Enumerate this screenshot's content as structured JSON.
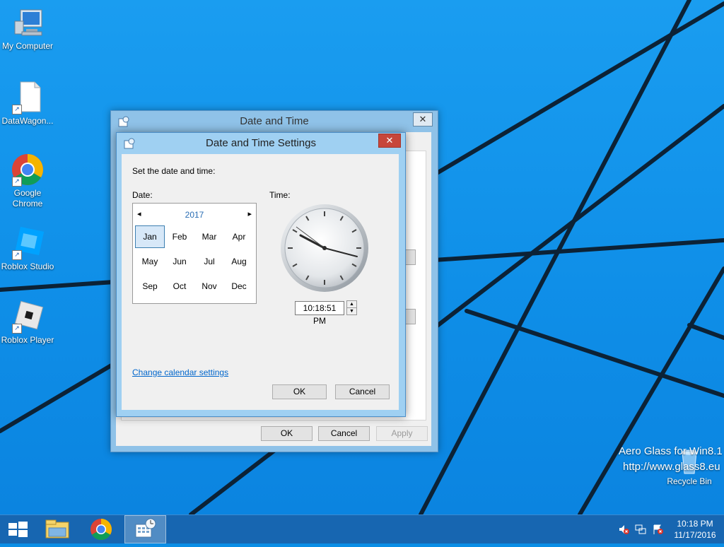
{
  "desktop": {
    "icons": [
      {
        "label": "My Computer"
      },
      {
        "label": "DataWagon..."
      },
      {
        "label": "Google Chrome"
      },
      {
        "label": "Roblox Studio"
      },
      {
        "label": "Roblox Player"
      },
      {
        "label": "Recycle Bin"
      }
    ],
    "watermark_line1": "Aero Glass for Win8.1",
    "watermark_line2": "http://www.glass8.eu"
  },
  "outer_dialog": {
    "title": "Date and Time",
    "close_label": "✕",
    "ok_label": "OK",
    "cancel_label": "Cancel",
    "apply_label": "Apply"
  },
  "inner_dialog": {
    "title": "Date and Time Settings",
    "close_label": "✕",
    "instruction": "Set the date and time:",
    "date_label": "Date:",
    "time_label": "Time:",
    "calendar": {
      "year": "2017",
      "prev_label": "◂",
      "next_label": "▸",
      "months": [
        "Jan",
        "Feb",
        "Mar",
        "Apr",
        "May",
        "Jun",
        "Jul",
        "Aug",
        "Sep",
        "Oct",
        "Nov",
        "Dec"
      ],
      "selected_month": "Jan"
    },
    "time_value": "10:18:51 PM",
    "change_calendar_link": "Change calendar settings",
    "ok_label": "OK",
    "cancel_label": "Cancel"
  },
  "taskbar": {
    "clock_time": "10:18 PM",
    "clock_date": "11/17/2016",
    "apps": [
      "start-button",
      "file-explorer",
      "google-chrome",
      "date-and-time"
    ]
  },
  "colors": {
    "desktop_blue": "#0f8fe8",
    "taskbar_blue": "#1766b1",
    "link_blue": "#0066cc",
    "year_blue": "#2a6db3"
  }
}
